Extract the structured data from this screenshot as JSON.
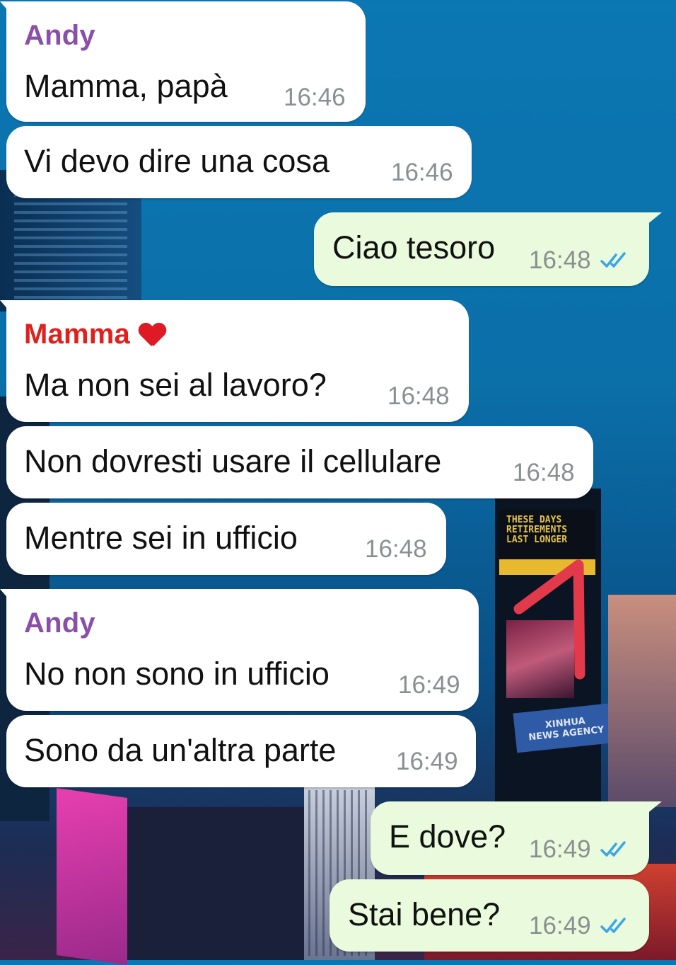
{
  "background": {
    "sign_times_square": [
      "THESE DAYS",
      "RETIREMENTS",
      "LAST LONGER"
    ],
    "sign_xinhua": [
      "XINHUA",
      "NEWS AGENCY"
    ]
  },
  "colors": {
    "incoming_bubble": "#ffffff",
    "outgoing_bubble": "#e9fbdc",
    "sender_andy": "#8a4fa8",
    "sender_mamma": "#e0201c",
    "timestamp": "#8a8f91",
    "read_ticks": "#3aa5e8",
    "annotation_arrow": "#e23a4a"
  },
  "messages": [
    {
      "direction": "in",
      "sender": "Andy",
      "text": "Mamma, papà",
      "time": "16:46"
    },
    {
      "direction": "in",
      "text": "Vi devo dire una cosa",
      "time": "16:46"
    },
    {
      "direction": "out",
      "text": "Ciao tesoro",
      "time": "16:48",
      "status": "read-double-check-icon"
    },
    {
      "direction": "in",
      "sender": "Mamma",
      "sender_icon": "red-heart-emoji",
      "text": "Ma non sei al lavoro?",
      "time": "16:48"
    },
    {
      "direction": "in",
      "text": "Non dovresti usare il cellulare",
      "time": "16:48"
    },
    {
      "direction": "in",
      "text": "Mentre sei in ufficio",
      "time": "16:48"
    },
    {
      "direction": "in",
      "sender": "Andy",
      "text": "No non sono in ufficio",
      "time": "16:49"
    },
    {
      "direction": "in",
      "text": "Sono da un'altra parte",
      "time": "16:49"
    },
    {
      "direction": "out",
      "text": "E dove?",
      "time": "16:49",
      "status": "read-double-check-icon"
    },
    {
      "direction": "out",
      "text": "Stai bene?",
      "time": "16:49",
      "status": "read-double-check-icon"
    }
  ]
}
